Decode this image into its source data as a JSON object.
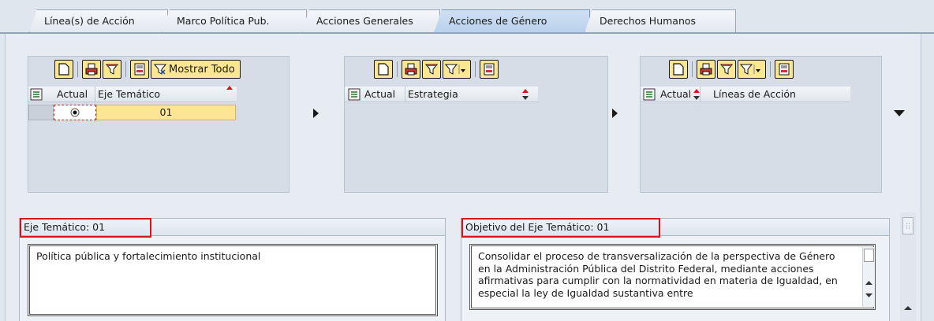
{
  "tabs": [
    {
      "label": "Línea(s) de Acción",
      "active": false
    },
    {
      "label": "Marco Política Pub.",
      "active": false
    },
    {
      "label": "Acciones Generales",
      "active": false
    },
    {
      "label": "Acciones de Género",
      "active": true
    },
    {
      "label": "Derechos Humanos",
      "active": false
    }
  ],
  "panel1": {
    "mostrar_todo": "Mostrar Todo",
    "col_actual": "Actual",
    "col_eje": "Eje Temático",
    "row_value": "01"
  },
  "panel2": {
    "col_actual": "Actual",
    "col_estrategia": "Estrategia"
  },
  "panel3": {
    "col_actual": "Actual",
    "col_lineas": "Líneas de Acción"
  },
  "eje_box": {
    "title": "Eje Temático: 01",
    "text": "Política pública y fortalecimiento institucional"
  },
  "objetivo_box": {
    "title": "Objetivo del Eje Temático: 01",
    "text": "Consolidar el proceso de transversalización de la perspectiva de Género en la Administración Pública del Distrito Federal, mediante acciones afirmativas para cumplir con la normatividad en materia de Igualdad, en especial la ley de Igualdad sustantiva entre"
  },
  "colors": {
    "accent_yellow": "#fbe692",
    "highlight_red": "#d7141c",
    "tab_active": "#b9d1ec"
  }
}
